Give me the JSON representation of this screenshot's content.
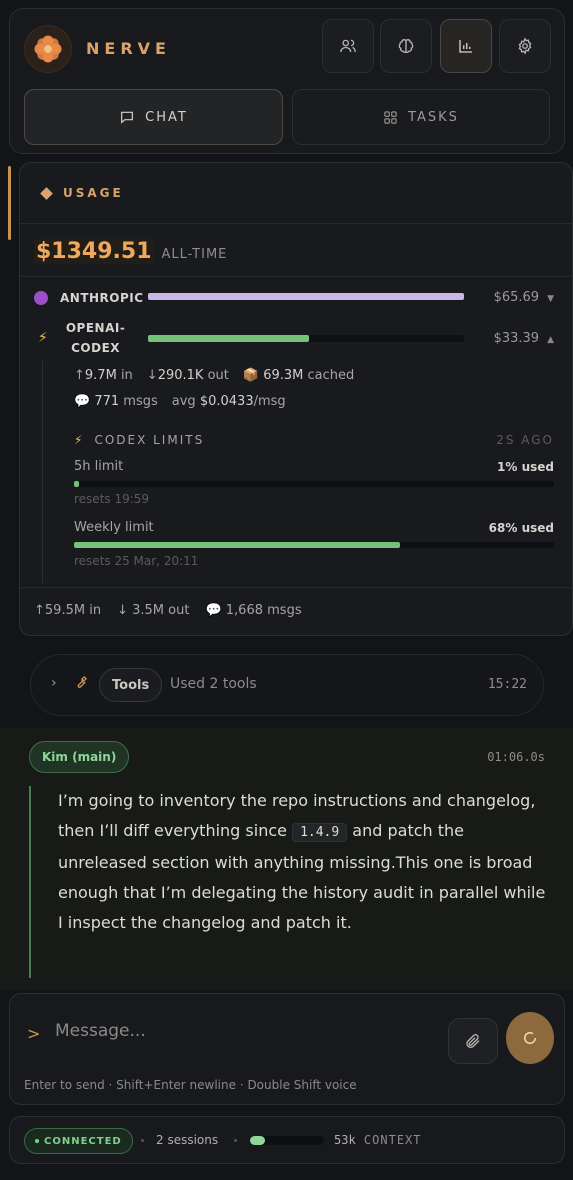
{
  "header": {
    "brand": "NERVE",
    "tabs": [
      {
        "label": "CHAT",
        "icon": "chat-bubble-icon",
        "active": true
      },
      {
        "label": "TASKS",
        "icon": "grid-icon",
        "active": false
      }
    ],
    "icon_buttons": [
      {
        "icon": "users-icon",
        "active": false
      },
      {
        "icon": "brain-icon",
        "active": false
      },
      {
        "icon": "bar-chart-icon",
        "active": true
      },
      {
        "icon": "gear-icon",
        "active": false
      }
    ]
  },
  "usage": {
    "title": "USAGE",
    "total_amount": "$1349.51",
    "total_label": "ALL-TIME",
    "providers": [
      {
        "name": "ANTHROPIC",
        "icon": "purple-circle-icon",
        "amount": "$65.69",
        "share": 1.0,
        "color": "#c8b6e6",
        "expanded": false
      },
      {
        "name_line1": "OPENAI-",
        "name_line2": "CODEX",
        "icon": "lightning-icon",
        "amount": "$33.39",
        "share": 0.51,
        "color": "#77c27a",
        "expanded": true
      }
    ],
    "codex": {
      "in": "9.7M",
      "in_label": "in",
      "out": "290.1K",
      "out_label": "out",
      "cached": "69.3M",
      "cached_label": "cached",
      "msgs": "771",
      "msgs_label": "msgs",
      "avg_prefix": "avg",
      "avg": "$0.0433",
      "avg_suffix": "/msg",
      "limits_title": "CODEX LIMITS",
      "limits_ago": "2S AGO",
      "limits": [
        {
          "label": "5h limit",
          "value": "1% used",
          "percent": 1,
          "resets": "resets 19:59"
        },
        {
          "label": "Weekly limit",
          "value": "68% used",
          "percent": 68,
          "resets": "resets 25 Mar, 20:11"
        }
      ]
    },
    "footer": {
      "in": "59.5M",
      "in_label": "in",
      "out": "3.5M",
      "out_label": "out",
      "msgs": "1,668",
      "msgs_label": "msgs"
    }
  },
  "tools": {
    "pill": "Tools",
    "summary": "Used 2 tools",
    "time": "15:22"
  },
  "message": {
    "agent": "Kim (main)",
    "duration": "01:06.0s",
    "text_before": "I’m going to inventory the repo instructions and changelog, then I’ll diff everything since ",
    "code": "1.4.9",
    "text_after": " and patch the unreleased section with anything missing.This one is broad enough that I’m delegating the history audit in parallel while I inspect the changelog and patch it."
  },
  "composer": {
    "prompt": ">",
    "placeholder": "Message...",
    "hint": "Enter to send · Shift+Enter newline · Double Shift voice"
  },
  "status": {
    "connection": "CONNECTED",
    "sessions": "2 sessions",
    "context_fill": 0.2,
    "context_value": "53k",
    "context_label": "CONTEXT"
  }
}
